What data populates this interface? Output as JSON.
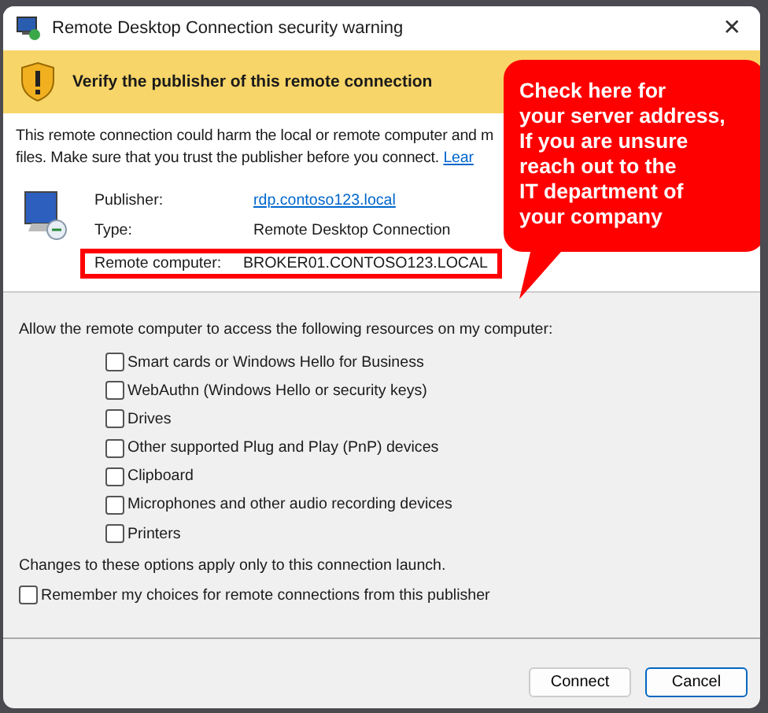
{
  "window": {
    "title": "Remote Desktop Connection security warning",
    "close": "✕"
  },
  "banner": {
    "text": "Verify the publisher of this remote connection"
  },
  "message": {
    "line_1": "This remote connection could harm the local or remote computer and m",
    "line_2": "files. Make sure that you trust the publisher before you connect.",
    "link": "Lear"
  },
  "details": [
    {
      "label": "Publisher:",
      "value": "rdp.contoso123.local",
      "kind": "link",
      "highlighted": false
    },
    {
      "label": "Type:",
      "value": "Remote Desktop Connection",
      "kind": "text",
      "highlighted": false
    },
    {
      "label": "Remote computer:",
      "value": "BROKER01.CONTOSO123.LOCAL",
      "kind": "text",
      "highlighted": true
    }
  ],
  "resources": {
    "prompt": "Allow the remote computer to access the following resources on my computer:",
    "items": [
      {
        "label": "Smart cards or Windows Hello for Business",
        "checked": false
      },
      {
        "label": "WebAuthn (Windows Hello or security keys)",
        "checked": false
      },
      {
        "label": "Drives",
        "checked": false
      },
      {
        "label": "Other supported Plug and Play (PnP) devices",
        "checked": false
      },
      {
        "label": "Clipboard",
        "checked": false
      },
      {
        "label": "Microphones and other audio recording devices",
        "checked": false
      },
      {
        "label": "Printers",
        "checked": false
      }
    ]
  },
  "note": "Changes to these options apply only to this connection launch.",
  "remember": {
    "label": "Remember my choices for remote connections from this publisher",
    "checked": false
  },
  "buttons": [
    {
      "label": "Connect",
      "default": false
    },
    {
      "label": "Cancel",
      "default": true
    }
  ],
  "callout": {
    "lines": [
      "Check here for",
      "your server address,",
      "If you are unsure",
      "reach out to the",
      "IT department of",
      "your company"
    ]
  }
}
